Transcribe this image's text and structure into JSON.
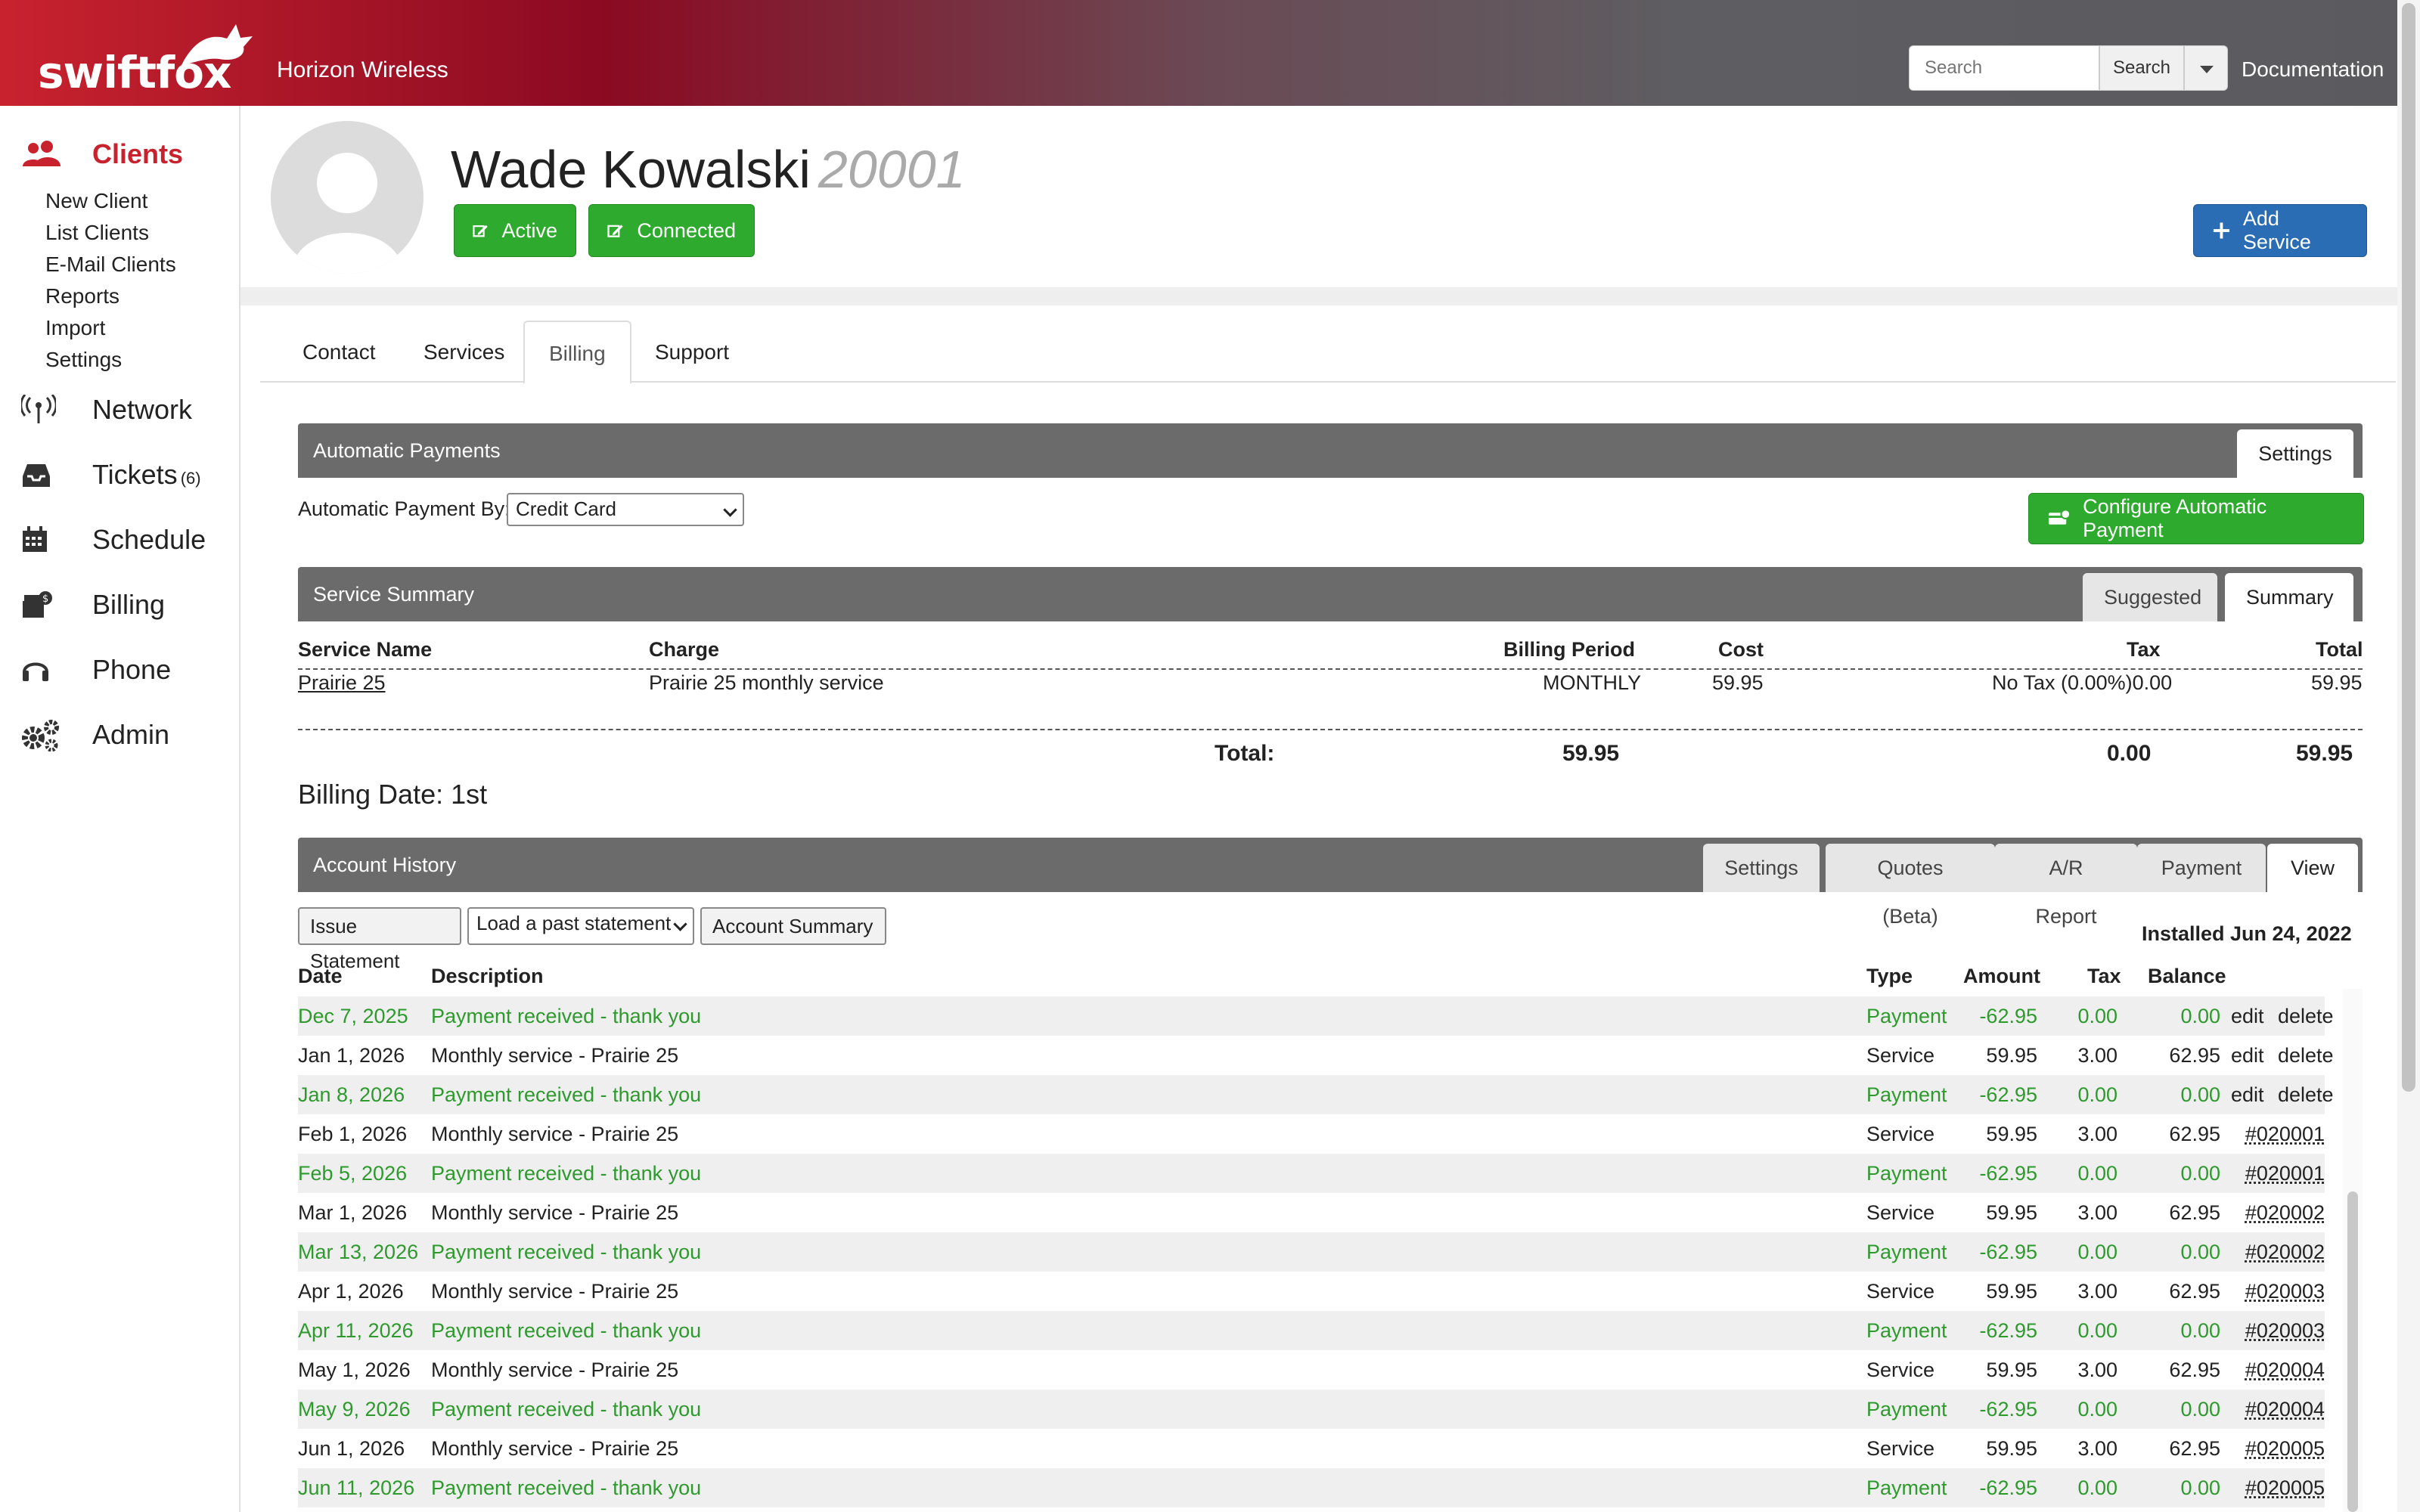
{
  "header": {
    "logo_text": "swiftfox",
    "company": "Horizon Wireless",
    "search_placeholder": "Search",
    "search_button": "Search",
    "documentation": "Documentation"
  },
  "sidebar": {
    "clients": "Clients",
    "clients_sub": [
      "New Client",
      "List Clients",
      "E-Mail Clients",
      "Reports",
      "Import",
      "Settings"
    ],
    "network": "Network",
    "tickets": "Tickets",
    "tickets_count": "(6)",
    "schedule": "Schedule",
    "billing": "Billing",
    "phone": "Phone",
    "admin": "Admin"
  },
  "client": {
    "name": "Wade Kowalski",
    "id": "20001",
    "status_active": "Active",
    "status_connected": "Connected",
    "add_service": "Add Service"
  },
  "tabs": [
    "Contact",
    "Services",
    "Billing",
    "Support"
  ],
  "auto_payments": {
    "title": "Automatic Payments",
    "settings_tab": "Settings",
    "label": "Automatic Payment By:",
    "selected": "Credit Card",
    "configure_button": "Configure Automatic Payment"
  },
  "service_summary": {
    "title": "Service Summary",
    "tab_suggested": "Suggested",
    "tab_summary": "Summary",
    "headers": [
      "Service Name",
      "Charge",
      "Billing Period",
      "Cost",
      "Tax",
      "Total"
    ],
    "row": {
      "name": "Prairie 25",
      "charge": "Prairie 25 monthly service",
      "period": "MONTHLY",
      "cost": "59.95",
      "tax": "No Tax (0.00%)0.00",
      "total": "59.95"
    },
    "total_label": "Total:",
    "total_cost": "59.95",
    "total_tax": "0.00",
    "total_total": "59.95"
  },
  "billing_date": {
    "label": "Billing Date:",
    "value": "1st"
  },
  "account_history": {
    "title": "Account History",
    "tabs": [
      "Settings",
      "Quotes (Beta)",
      "A/R Report",
      "Payment",
      "View"
    ],
    "issue_statement": "Issue Statement",
    "past_statement": "Load a past statement",
    "account_summary": "Account Summary",
    "installed": "Installed Jun 24, 2022",
    "headers": [
      "Date",
      "Description",
      "Type",
      "Amount",
      "Tax",
      "Balance"
    ],
    "rows": [
      {
        "date": "Dec 7, 2025",
        "desc": "Payment received - thank you",
        "type": "Payment",
        "amount": "-62.95",
        "tax": "0.00",
        "balance": "0.00",
        "edit": "edit",
        "delete": "delete"
      },
      {
        "date": "Jan 1, 2026",
        "desc": "Monthly service - Prairie 25",
        "type": "Service",
        "amount": "59.95",
        "tax": "3.00",
        "balance": "62.95",
        "edit": "edit",
        "delete": "delete"
      },
      {
        "date": "Jan 8, 2026",
        "desc": "Payment received - thank you",
        "type": "Payment",
        "amount": "-62.95",
        "tax": "0.00",
        "balance": "0.00",
        "edit": "edit",
        "delete": "delete"
      },
      {
        "date": "Feb 1, 2026",
        "desc": "Monthly service - Prairie 25",
        "type": "Service",
        "amount": "59.95",
        "tax": "3.00",
        "balance": "62.95",
        "ref": "#020001"
      },
      {
        "date": "Feb 5, 2026",
        "desc": "Payment received - thank you",
        "type": "Payment",
        "amount": "-62.95",
        "tax": "0.00",
        "balance": "0.00",
        "ref": "#020001"
      },
      {
        "date": "Mar 1, 2026",
        "desc": "Monthly service - Prairie 25",
        "type": "Service",
        "amount": "59.95",
        "tax": "3.00",
        "balance": "62.95",
        "ref": "#020002"
      },
      {
        "date": "Mar 13, 2026",
        "desc": "Payment received - thank you",
        "type": "Payment",
        "amount": "-62.95",
        "tax": "0.00",
        "balance": "0.00",
        "ref": "#020002"
      },
      {
        "date": "Apr 1, 2026",
        "desc": "Monthly service - Prairie 25",
        "type": "Service",
        "amount": "59.95",
        "tax": "3.00",
        "balance": "62.95",
        "ref": "#020003"
      },
      {
        "date": "Apr 11, 2026",
        "desc": "Payment received - thank you",
        "type": "Payment",
        "amount": "-62.95",
        "tax": "0.00",
        "balance": "0.00",
        "ref": "#020003"
      },
      {
        "date": "May 1, 2026",
        "desc": "Monthly service - Prairie 25",
        "type": "Service",
        "amount": "59.95",
        "tax": "3.00",
        "balance": "62.95",
        "ref": "#020004"
      },
      {
        "date": "May 9, 2026",
        "desc": "Payment received - thank you",
        "type": "Payment",
        "amount": "-62.95",
        "tax": "0.00",
        "balance": "0.00",
        "ref": "#020004"
      },
      {
        "date": "Jun 1, 2026",
        "desc": "Monthly service - Prairie 25",
        "type": "Service",
        "amount": "59.95",
        "tax": "3.00",
        "balance": "62.95",
        "ref": "#020005"
      },
      {
        "date": "Jun 11, 2026",
        "desc": "Payment received - thank you",
        "type": "Payment",
        "amount": "-62.95",
        "tax": "0.00",
        "balance": "0.00",
        "ref": "#020005"
      }
    ]
  },
  "colors": {
    "brand_red": "#c8222e",
    "success_green": "#2eab2e",
    "primary_blue": "#2a6db5",
    "payment_text": "#2e9a2e"
  }
}
